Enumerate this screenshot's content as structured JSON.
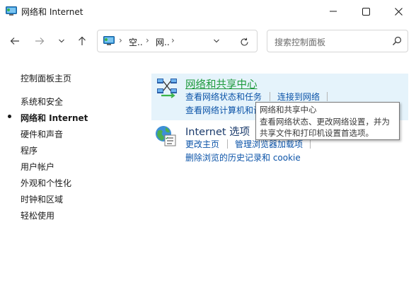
{
  "window": {
    "title": "网络和 Internet",
    "controls": {
      "minimize": "minimize-icon",
      "maximize": "maximize-icon",
      "close": "close-icon"
    }
  },
  "nav": {
    "back_icon": "back-arrow-icon",
    "forward_icon": "forward-arrow-icon",
    "recent_icon": "chevron-down-icon",
    "up_icon": "up-arrow-icon",
    "breadcrumbs": [
      "空..",
      "网.."
    ],
    "search_placeholder": "搜索控制面板"
  },
  "sidebar": {
    "items": [
      {
        "label": "控制面板主页",
        "active": false
      },
      {
        "label": "系统和安全",
        "active": false
      },
      {
        "label": "网络和 Internet",
        "active": true
      },
      {
        "label": "硬件和声音",
        "active": false
      },
      {
        "label": "程序",
        "active": false
      },
      {
        "label": "用户帐户",
        "active": false
      },
      {
        "label": "外观和个性化",
        "active": false
      },
      {
        "label": "时钟和区域",
        "active": false
      },
      {
        "label": "轻松使用",
        "active": false
      }
    ]
  },
  "categories": [
    {
      "title": "网络和共享中心",
      "icon": "network-sharing-icon",
      "links": [
        "查看网络状态和任务",
        "连接到网络",
        "查看网络计算机和设"
      ]
    },
    {
      "title": "Internet 选项",
      "icon": "internet-options-icon",
      "links": [
        "更改主页",
        "管理浏览器加载项",
        "删除浏览的历史记录和 cookie"
      ]
    }
  ],
  "tooltip": {
    "lines": [
      "网络和共享中心",
      "查看网络状态、更改网络设置，并为",
      "共享文件和打印机设置首选项。"
    ]
  },
  "colors": {
    "link": "#0b53a8",
    "hover_title": "#1e9a3c",
    "title": "#1a3a6b",
    "highlight": "#e5f3fb"
  }
}
